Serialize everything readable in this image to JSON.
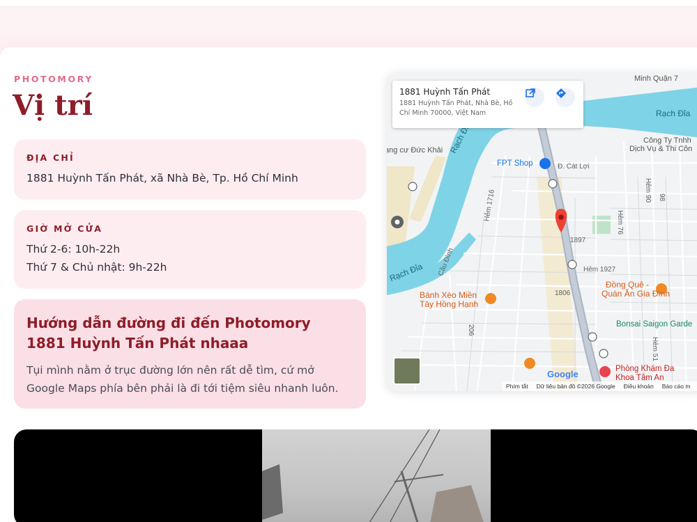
{
  "section": {
    "kicker": "PHOTOMORY",
    "title": "Vị trí"
  },
  "address_card": {
    "label": "ĐỊA CHỈ",
    "value": "1881 Huỳnh Tấn Phát, xã Nhà Bè, Tp. Hồ Chí Minh"
  },
  "hours_card": {
    "label": "GIỜ MỞ CỬA",
    "lines": [
      "Thứ 2-6: 10h-22h",
      "Thứ 7 & Chủ nhật: 9h-22h"
    ]
  },
  "guide_card": {
    "title": "Hướng dẫn đường đi đến Photomory 1881 Huỳnh Tấn Phát nhaaa",
    "desc": "Tụi mình nằm ở trục đường lớn nên rất dễ tìm, cứ mở Google Maps phía bên phải là đi tới tiệm siêu nhanh luôn."
  },
  "map": {
    "place_title": "1881 Huỳnh Tấn Phát",
    "place_address": "1881 Huỳnh Tấn Phát, Nhà Bè, Hồ Chí Minh 70000, Việt Nam",
    "labels": {
      "minh_quan": "Minh Quận 7",
      "rach_dia_top": "Rạch Đỉa",
      "rach_dia_bottom": "Rạch Đỉa",
      "rach_dia_vertical": "Rạch Đỉa",
      "cong_ty": "Công Ty Tnhh",
      "dich_vu": "Dịch Vụ & Thi Côn",
      "duc_khai": "ạng cư Đức Khải",
      "fpt_shop": "FPT Shop",
      "d_cat_loi": "Đ. Cát Lợi",
      "hem_76": "Hẻm 76",
      "hem_90": "Hẻm 90",
      "num_98": "98",
      "hem_1716": "Hẻm 1716",
      "road_1897": "1897",
      "hem_1927": "Hẻm 1927",
      "cau_dinh": "Cầu Đình",
      "banh_xeo_1": "Bánh Xèo Miền",
      "banh_xeo_2": "Tây Hồng Hạnh",
      "dong_que_1": "Đồng Quê -",
      "dong_que_2": "Quán Ăn Gia Đình",
      "road_1806": "1806",
      "bonsai": "Bonsai Saigon Garde",
      "hem_206": "206",
      "hem_51": "Hẻm 51",
      "phong_kham_1": "Phòng Khám Đa",
      "phong_kham_2": "Khoa Tâm An",
      "google": "Google"
    },
    "footer": {
      "shortcuts": "Phím tắt",
      "data": "Dữ liệu bản đồ ©2026 Google",
      "terms": "Điều khoản",
      "report": "Báo cáo m"
    }
  },
  "colors": {
    "accent": "#8e1d29",
    "kicker": "#e26b8c",
    "card_bg": "#fdedf0",
    "guide_bg": "#fbdfe6",
    "water": "#7fd3e6",
    "pin": "#ea4335"
  }
}
